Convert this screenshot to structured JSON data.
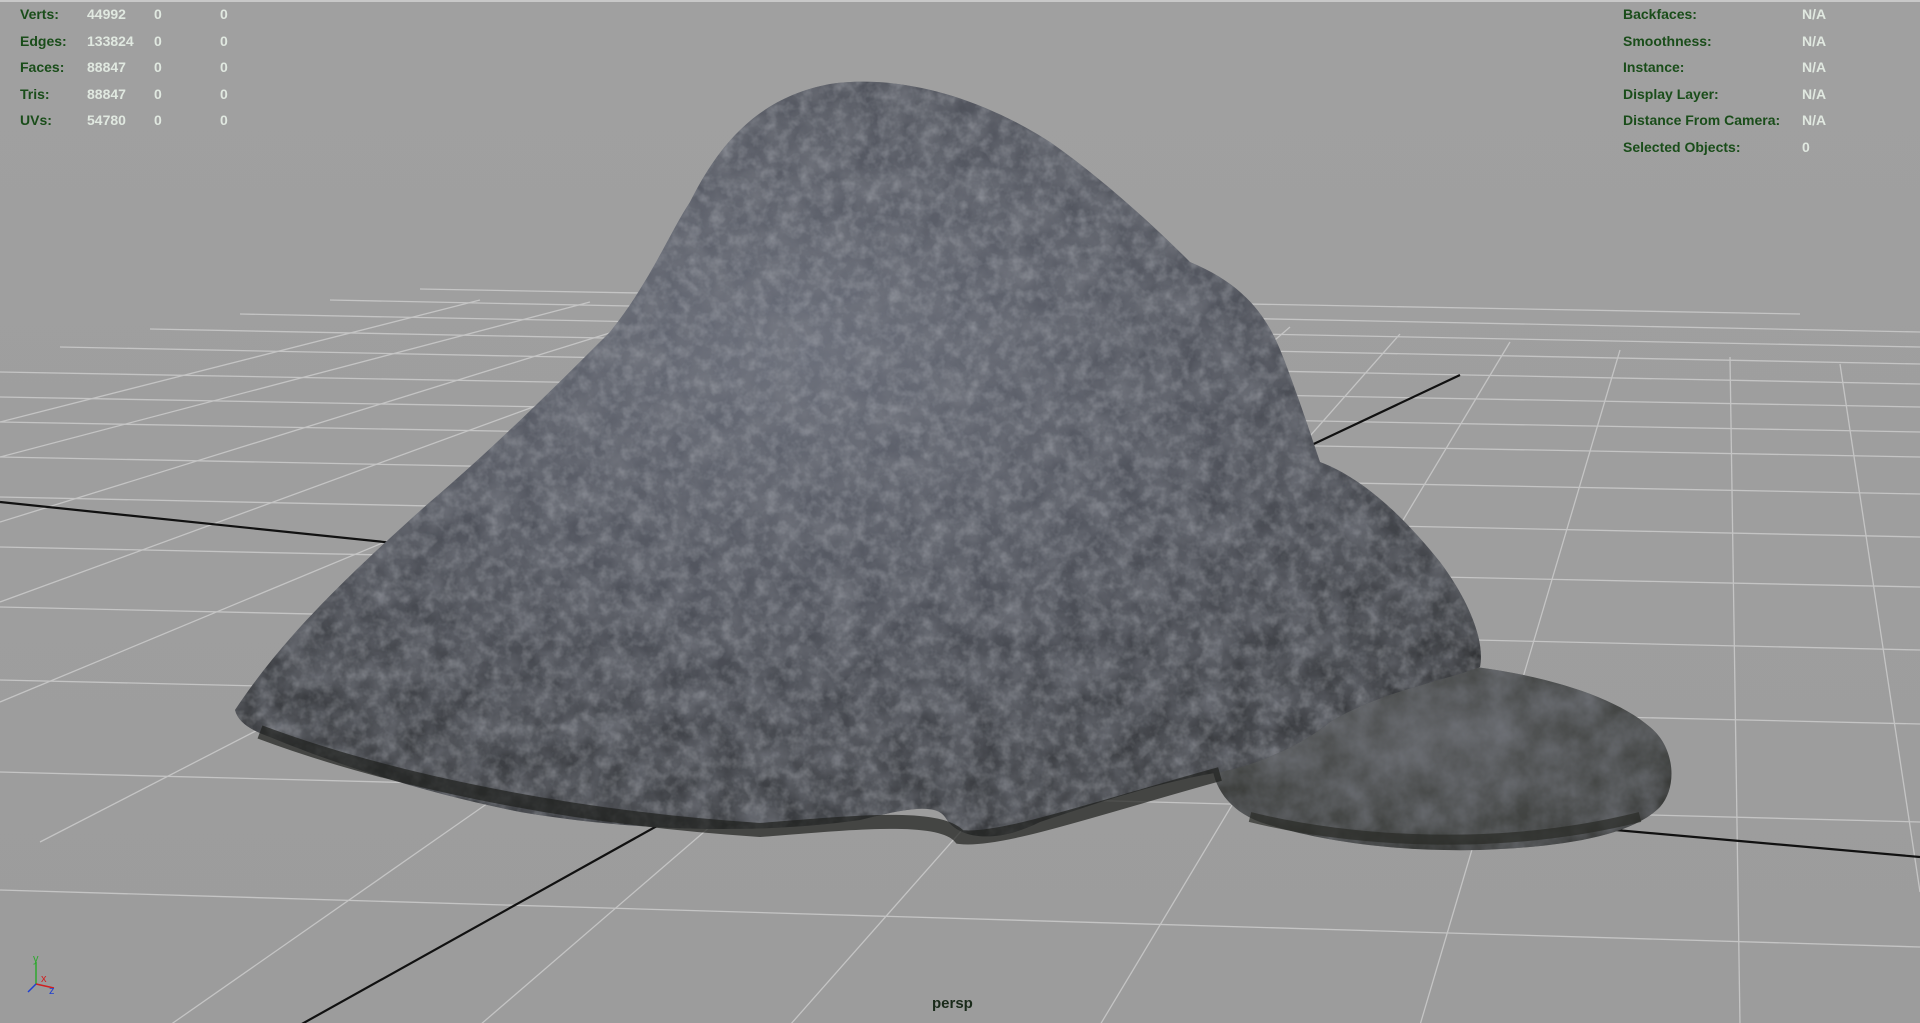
{
  "stats": [
    {
      "label": "Verts:",
      "values": [
        "44992",
        "0",
        "0"
      ]
    },
    {
      "label": "Edges:",
      "values": [
        "133824",
        "0",
        "0"
      ]
    },
    {
      "label": "Faces:",
      "values": [
        "88847",
        "0",
        "0"
      ]
    },
    {
      "label": "Tris:",
      "values": [
        "88847",
        "0",
        "0"
      ]
    },
    {
      "label": "UVs:",
      "values": [
        "54780",
        "0",
        "0"
      ]
    }
  ],
  "info": [
    {
      "label": "Backfaces:",
      "value": "N/A"
    },
    {
      "label": "Smoothness:",
      "value": "N/A"
    },
    {
      "label": "Instance:",
      "value": "N/A"
    },
    {
      "label": "Display Layer:",
      "value": "N/A"
    },
    {
      "label": "Distance From Camera:",
      "value": "N/A"
    },
    {
      "label": "Selected Objects:",
      "value": "0"
    }
  ],
  "camera": "persp",
  "axis_labels": {
    "y": "y",
    "x": "x",
    "z": "z"
  },
  "colors": {
    "background": "#9e9e9e",
    "grid": "#c4c4c4",
    "axis_line": "#111111",
    "hud_label": "#1a4d1a",
    "hud_value": "#e0e8e0",
    "rock": "#4a4d55"
  }
}
